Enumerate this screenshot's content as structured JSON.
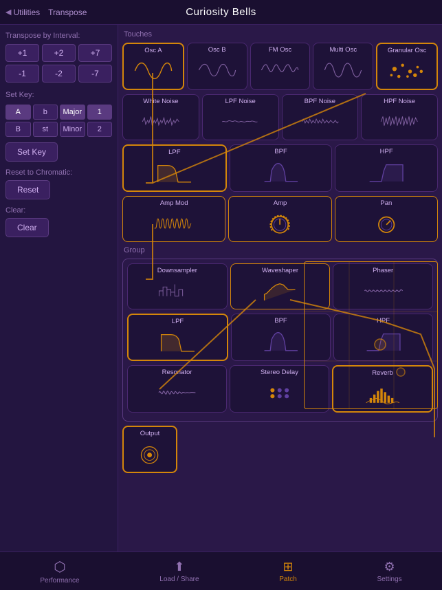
{
  "header": {
    "title": "Curiosity Bells",
    "utilities_label": "Utilities",
    "transpose_label": "Transpose"
  },
  "sidebar": {
    "transpose_section": "Transpose by Interval:",
    "buttons": [
      {
        "label": "+1",
        "id": "plus1"
      },
      {
        "label": "+2",
        "id": "plus2"
      },
      {
        "label": "+7",
        "id": "plus7"
      },
      {
        "label": "-1",
        "id": "minus1"
      },
      {
        "label": "-2",
        "id": "minus2"
      },
      {
        "label": "-7",
        "id": "minus7"
      }
    ],
    "set_key_label": "Set Key:",
    "key_row1": [
      "A",
      "b",
      "Major",
      "1"
    ],
    "key_row2": [
      "B",
      "st",
      "Minor",
      "2"
    ],
    "set_key_btn": "Set Key",
    "reset_section": "Reset to Chromatic:",
    "reset_btn": "Reset",
    "clear_section": "Clear:",
    "clear_btn": "Clear"
  },
  "main": {
    "touches_label": "Touches",
    "group_label": "Group",
    "nodes": {
      "osc_a": "Osc A",
      "osc_b": "Osc B",
      "fm_osc": "FM Osc",
      "multi_osc": "Multi Osc",
      "granular_osc": "Granular Osc",
      "white_noise": "White Noise",
      "lpf_noise": "LPF Noise",
      "bpf_noise": "BPF Noise",
      "hpf_noise": "HPF Noise",
      "lpf": "LPF",
      "bpf": "BPF",
      "hpf": "HPF",
      "amp_mod": "Amp Mod",
      "amp": "Amp",
      "pan": "Pan",
      "downsampler": "Downsampler",
      "waveshaper": "Waveshaper",
      "phaser": "Phaser",
      "lpf2": "LPF",
      "bpf2": "BPF",
      "hpf2": "HPF",
      "resonator": "Resonator",
      "stereo_delay": "Stereo Delay",
      "reverb": "Reverb",
      "output": "Output"
    }
  },
  "bottom_nav": {
    "items": [
      {
        "label": "Performance",
        "icon": "⬡",
        "active": false
      },
      {
        "label": "Load / Share",
        "icon": "↑",
        "active": false
      },
      {
        "label": "Patch",
        "icon": "⊞",
        "active": true
      },
      {
        "label": "Settings",
        "icon": "⚙",
        "active": false
      }
    ]
  },
  "colors": {
    "accent": "#d4860a",
    "bg_dark": "#1a0f30",
    "bg_mid": "#2a1848",
    "border_active": "#d4860a",
    "border_inactive": "#4a2870"
  }
}
